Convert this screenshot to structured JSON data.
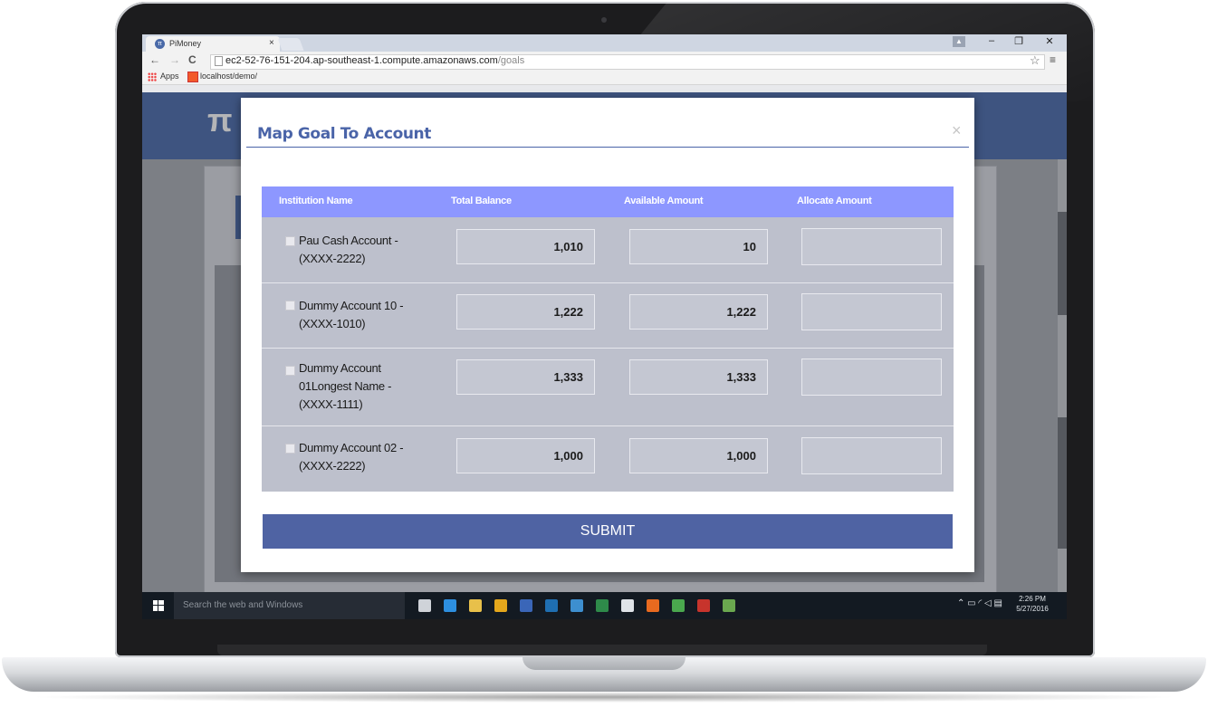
{
  "browser": {
    "tab_title": "PiMoney",
    "tab_close": "×",
    "url_host": "ec2-52-76-151-204.ap-southeast-1.compute.amazonaws.com",
    "url_path": "/goals",
    "bookmarks": [
      {
        "label": "Apps",
        "icon": "apps-grid-icon"
      },
      {
        "label": "localhost/demo/",
        "icon": "localhost-icon"
      }
    ],
    "window_controls": {
      "minimize": "–",
      "restore": "❐",
      "close": "✕"
    }
  },
  "modal": {
    "title": "Map Goal To Account",
    "close": "×",
    "columns": [
      "Institution Name",
      "Total Balance",
      "Available Amount",
      "Allocate Amount"
    ],
    "rows": [
      {
        "name": "Pau Cash Account - (XXXX-2222)",
        "total_balance": "1,010",
        "available_amount": "10",
        "allocate_amount": ""
      },
      {
        "name": "Dummy Account 10 - (XXXX-1010)",
        "total_balance": "1,222",
        "available_amount": "1,222",
        "allocate_amount": ""
      },
      {
        "name": "Dummy Account 01Longest Name - (XXXX-1111)",
        "total_balance": "1,333",
        "available_amount": "1,333",
        "allocate_amount": ""
      },
      {
        "name": "Dummy Account 02 - (XXXX-2222)",
        "total_balance": "1,000",
        "available_amount": "1,000",
        "allocate_amount": ""
      }
    ],
    "submit_label": "SUBMIT"
  },
  "taskbar": {
    "search_placeholder": "Search the web and Windows",
    "clock_time": "2:26 PM",
    "clock_date": "5/27/2016",
    "apps": [
      {
        "icon": "task-view-icon",
        "color": "#cfd3d9"
      },
      {
        "icon": "edge-icon",
        "color": "#2d8fe0"
      },
      {
        "icon": "file-explorer-icon",
        "color": "#e8c04a"
      },
      {
        "icon": "chrome-icon",
        "color": "#e4a71c"
      },
      {
        "icon": "app-icon",
        "color": "#3a66b8"
      },
      {
        "icon": "photoshop-icon",
        "color": "#1f6fb2"
      },
      {
        "icon": "app-icon",
        "color": "#3d8fd0"
      },
      {
        "icon": "excel-icon",
        "color": "#2e8a4a"
      },
      {
        "icon": "store-icon",
        "color": "#dfe3e8"
      },
      {
        "icon": "firefox-icon",
        "color": "#e86a1f"
      },
      {
        "icon": "app-icon",
        "color": "#4aa84e"
      },
      {
        "icon": "filezilla-icon",
        "color": "#c7342c"
      },
      {
        "icon": "app-icon",
        "color": "#6aa84f"
      }
    ]
  }
}
